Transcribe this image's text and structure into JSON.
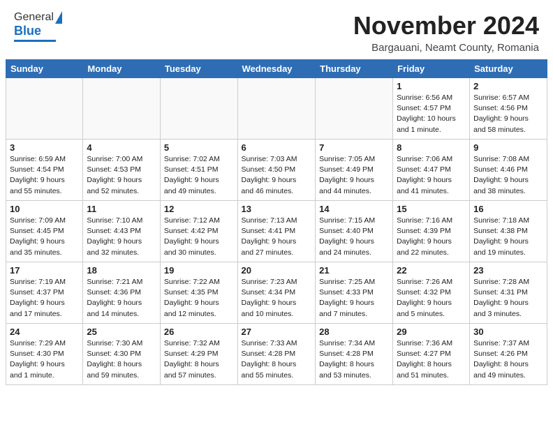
{
  "header": {
    "logo_general": "General",
    "logo_blue": "Blue",
    "month_title": "November 2024",
    "location": "Bargauani, Neamt County, Romania"
  },
  "weekdays": [
    "Sunday",
    "Monday",
    "Tuesday",
    "Wednesday",
    "Thursday",
    "Friday",
    "Saturday"
  ],
  "weeks": [
    [
      {
        "day": "",
        "info": ""
      },
      {
        "day": "",
        "info": ""
      },
      {
        "day": "",
        "info": ""
      },
      {
        "day": "",
        "info": ""
      },
      {
        "day": "",
        "info": ""
      },
      {
        "day": "1",
        "info": "Sunrise: 6:56 AM\nSunset: 4:57 PM\nDaylight: 10 hours\nand 1 minute."
      },
      {
        "day": "2",
        "info": "Sunrise: 6:57 AM\nSunset: 4:56 PM\nDaylight: 9 hours\nand 58 minutes."
      }
    ],
    [
      {
        "day": "3",
        "info": "Sunrise: 6:59 AM\nSunset: 4:54 PM\nDaylight: 9 hours\nand 55 minutes."
      },
      {
        "day": "4",
        "info": "Sunrise: 7:00 AM\nSunset: 4:53 PM\nDaylight: 9 hours\nand 52 minutes."
      },
      {
        "day": "5",
        "info": "Sunrise: 7:02 AM\nSunset: 4:51 PM\nDaylight: 9 hours\nand 49 minutes."
      },
      {
        "day": "6",
        "info": "Sunrise: 7:03 AM\nSunset: 4:50 PM\nDaylight: 9 hours\nand 46 minutes."
      },
      {
        "day": "7",
        "info": "Sunrise: 7:05 AM\nSunset: 4:49 PM\nDaylight: 9 hours\nand 44 minutes."
      },
      {
        "day": "8",
        "info": "Sunrise: 7:06 AM\nSunset: 4:47 PM\nDaylight: 9 hours\nand 41 minutes."
      },
      {
        "day": "9",
        "info": "Sunrise: 7:08 AM\nSunset: 4:46 PM\nDaylight: 9 hours\nand 38 minutes."
      }
    ],
    [
      {
        "day": "10",
        "info": "Sunrise: 7:09 AM\nSunset: 4:45 PM\nDaylight: 9 hours\nand 35 minutes."
      },
      {
        "day": "11",
        "info": "Sunrise: 7:10 AM\nSunset: 4:43 PM\nDaylight: 9 hours\nand 32 minutes."
      },
      {
        "day": "12",
        "info": "Sunrise: 7:12 AM\nSunset: 4:42 PM\nDaylight: 9 hours\nand 30 minutes."
      },
      {
        "day": "13",
        "info": "Sunrise: 7:13 AM\nSunset: 4:41 PM\nDaylight: 9 hours\nand 27 minutes."
      },
      {
        "day": "14",
        "info": "Sunrise: 7:15 AM\nSunset: 4:40 PM\nDaylight: 9 hours\nand 24 minutes."
      },
      {
        "day": "15",
        "info": "Sunrise: 7:16 AM\nSunset: 4:39 PM\nDaylight: 9 hours\nand 22 minutes."
      },
      {
        "day": "16",
        "info": "Sunrise: 7:18 AM\nSunset: 4:38 PM\nDaylight: 9 hours\nand 19 minutes."
      }
    ],
    [
      {
        "day": "17",
        "info": "Sunrise: 7:19 AM\nSunset: 4:37 PM\nDaylight: 9 hours\nand 17 minutes."
      },
      {
        "day": "18",
        "info": "Sunrise: 7:21 AM\nSunset: 4:36 PM\nDaylight: 9 hours\nand 14 minutes."
      },
      {
        "day": "19",
        "info": "Sunrise: 7:22 AM\nSunset: 4:35 PM\nDaylight: 9 hours\nand 12 minutes."
      },
      {
        "day": "20",
        "info": "Sunrise: 7:23 AM\nSunset: 4:34 PM\nDaylight: 9 hours\nand 10 minutes."
      },
      {
        "day": "21",
        "info": "Sunrise: 7:25 AM\nSunset: 4:33 PM\nDaylight: 9 hours\nand 7 minutes."
      },
      {
        "day": "22",
        "info": "Sunrise: 7:26 AM\nSunset: 4:32 PM\nDaylight: 9 hours\nand 5 minutes."
      },
      {
        "day": "23",
        "info": "Sunrise: 7:28 AM\nSunset: 4:31 PM\nDaylight: 9 hours\nand 3 minutes."
      }
    ],
    [
      {
        "day": "24",
        "info": "Sunrise: 7:29 AM\nSunset: 4:30 PM\nDaylight: 9 hours\nand 1 minute."
      },
      {
        "day": "25",
        "info": "Sunrise: 7:30 AM\nSunset: 4:30 PM\nDaylight: 8 hours\nand 59 minutes."
      },
      {
        "day": "26",
        "info": "Sunrise: 7:32 AM\nSunset: 4:29 PM\nDaylight: 8 hours\nand 57 minutes."
      },
      {
        "day": "27",
        "info": "Sunrise: 7:33 AM\nSunset: 4:28 PM\nDaylight: 8 hours\nand 55 minutes."
      },
      {
        "day": "28",
        "info": "Sunrise: 7:34 AM\nSunset: 4:28 PM\nDaylight: 8 hours\nand 53 minutes."
      },
      {
        "day": "29",
        "info": "Sunrise: 7:36 AM\nSunset: 4:27 PM\nDaylight: 8 hours\nand 51 minutes."
      },
      {
        "day": "30",
        "info": "Sunrise: 7:37 AM\nSunset: 4:26 PM\nDaylight: 8 hours\nand 49 minutes."
      }
    ]
  ]
}
